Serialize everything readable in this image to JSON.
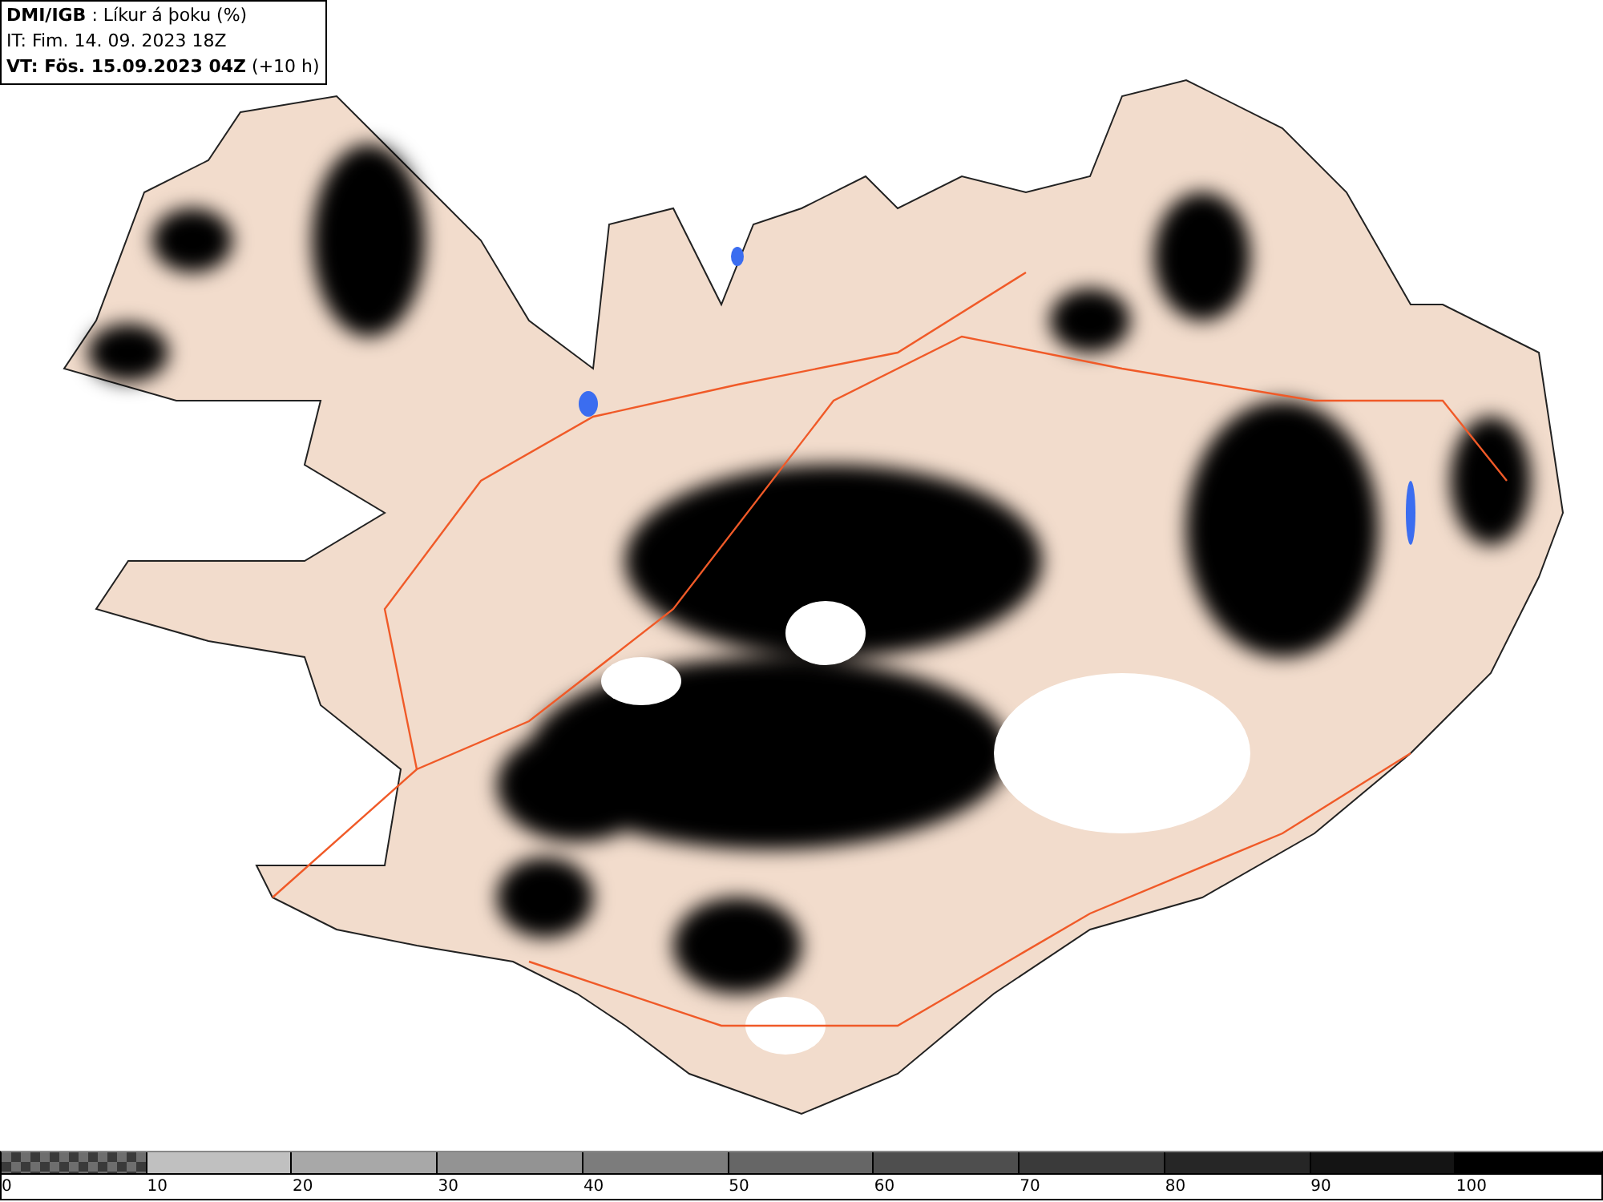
{
  "header": {
    "source": "DMI/IGB",
    "title": " : Líkur á þoku (%)",
    "issue_time": "IT: Fim. 14. 09. 2023 18Z",
    "valid_time": "VT: Fös. 15.09.2023 04Z",
    "lead": "(+10 h)"
  },
  "legend": {
    "bins": [
      {
        "label": "0",
        "kind": "checker",
        "color": "#6e6e6e"
      },
      {
        "label": "10",
        "kind": "solid",
        "color": "#c0c0c0"
      },
      {
        "label": "20",
        "kind": "solid",
        "color": "#a8a8a8"
      },
      {
        "label": "30",
        "kind": "solid",
        "color": "#939393"
      },
      {
        "label": "40",
        "kind": "solid",
        "color": "#7c7c7c"
      },
      {
        "label": "50",
        "kind": "solid",
        "color": "#666666"
      },
      {
        "label": "60",
        "kind": "solid",
        "color": "#4e4e4e"
      },
      {
        "label": "70",
        "kind": "solid",
        "color": "#3a3a3a"
      },
      {
        "label": "80",
        "kind": "solid",
        "color": "#262626"
      },
      {
        "label": "90",
        "kind": "solid",
        "color": "#141414"
      },
      {
        "label": "100",
        "kind": "solid",
        "color": "#000000"
      }
    ]
  }
}
